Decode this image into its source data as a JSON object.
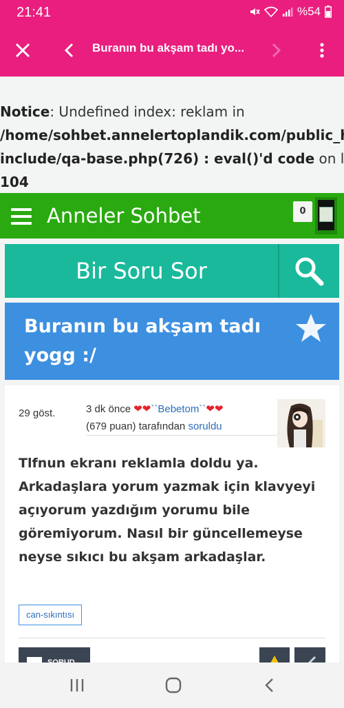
{
  "status_bar": {
    "time": "21:41",
    "battery": "%54",
    "icons": [
      "mute-icon",
      "wifi-icon",
      "signal-icon",
      "battery-icon"
    ]
  },
  "toolbar": {
    "title": "Buranın bu akşam tadı yo...",
    "icons": [
      "close-icon",
      "back-icon",
      "forward-icon",
      "more-vert-icon"
    ]
  },
  "notice": {
    "label": "Notice",
    "line1_rest": ": Undefined index: reklam in",
    "line2": "/home/sohbet.annelertoplandik.com/public_html/",
    "line3_bold": "include/qa-base.php(726) : eval()'d code",
    "line3_rest": " on line",
    "line4": "104"
  },
  "site": {
    "title": "Anneler Sohbet",
    "notification_count": "0",
    "accent_color": "#2aaa10"
  },
  "ask": {
    "label": "Bir Soru Sor",
    "color": "#1ab99c"
  },
  "question": {
    "title": "Buranın bu akşam tadı yogg :/",
    "views": "29 göst.",
    "meta_time": "3 dk önce ",
    "meta_hearts_left": "❤❤",
    "meta_user": "``Bebetom``",
    "meta_hearts_right": "❤❤",
    "meta_points": "(679 puan) tarafından ",
    "meta_action": "soruldu",
    "body": "Tlfnun ekranı reklamla doldu ya. Arkadaşlara yorum yazmak için klavyeyi açıyorum yazdığım yorumu bile göremiyorum. Nasıl bir güncellemeyse neyse sıkıcı bu akşam arkadaşlar.",
    "tag": "can-sıkıntısı",
    "action_label": "SORUD"
  }
}
